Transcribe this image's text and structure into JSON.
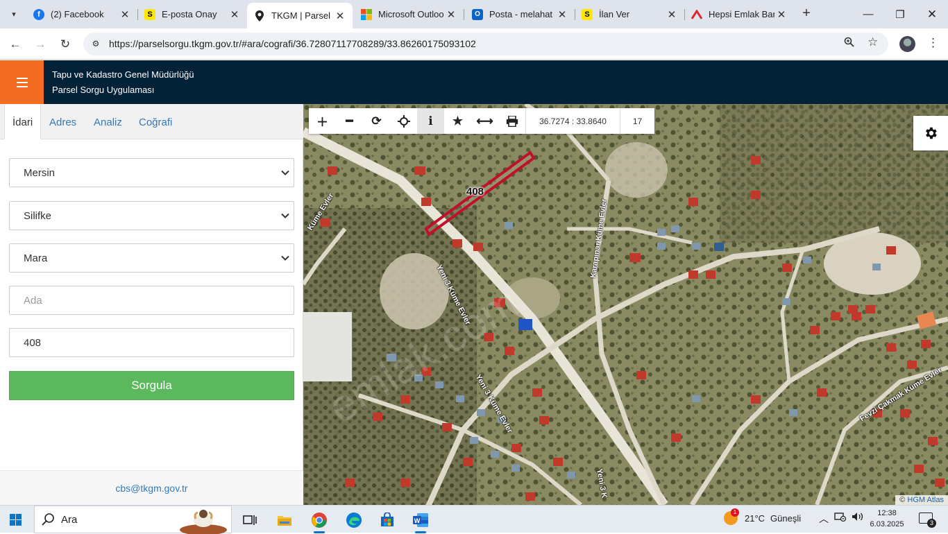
{
  "browser": {
    "tabs": [
      {
        "title": "(2) Facebook",
        "icon": "facebook-icon"
      },
      {
        "title": "E-posta Onay",
        "icon": "sahibinden-icon"
      },
      {
        "title": "TKGM | Parsel Sorgu",
        "icon": "location-pin-icon",
        "active": true
      },
      {
        "title": "Microsoft Outlook",
        "icon": "microsoft-icon"
      },
      {
        "title": "Posta - melahat",
        "icon": "outlook-icon"
      },
      {
        "title": "İlan Ver",
        "icon": "sahibinden-icon"
      },
      {
        "title": "Hepsi Emlak Bana",
        "icon": "hepsiemlak-icon"
      }
    ],
    "url": "https://parselsorgu.tkgm.gov.tr/#ara/cografi/36.72807117708289/33.86260175093102"
  },
  "app": {
    "title_line1": "Tapu ve Kadastro Genel Müdürlüğü",
    "title_line2": "Parsel Sorgu Uygulaması"
  },
  "panel": {
    "tabs": [
      "İdari",
      "Adres",
      "Analiz",
      "Coğrafi"
    ],
    "il": "Mersin",
    "ilce": "Silifke",
    "mahalle": "Mara",
    "ada_placeholder": "Ada",
    "parsel_value": "408",
    "submit_label": "Sorgula",
    "footer_email": "cbs@tkgm.gov.tr"
  },
  "map": {
    "coordinates": "36.7274 : 33.8640",
    "zoom_level": "17",
    "parcel_label": "408",
    "attribution_prefix": "© ",
    "attribution": "HGM Atlas",
    "road_labels": [
      "Yeni 3 Küme Evler",
      "Karapınar Küme Evler",
      "Yeni 3 Küme Evler",
      "Fevzi Çakmak Küme Evler",
      "Küme Evler",
      "Yeni 3 K"
    ]
  },
  "taskbar": {
    "search_text": "Ara",
    "weather_temp": "21°C",
    "weather_desc": "Güneşli",
    "weather_badge": "1",
    "time": "12:38",
    "date": "6.03.2025",
    "notif_count": "3"
  },
  "colors": {
    "header_bg": "#032137",
    "menu_orange": "#f26c22",
    "submit_green": "#5cb85c",
    "link_blue": "#337ab7",
    "parcel_outline": "#c0102a"
  }
}
